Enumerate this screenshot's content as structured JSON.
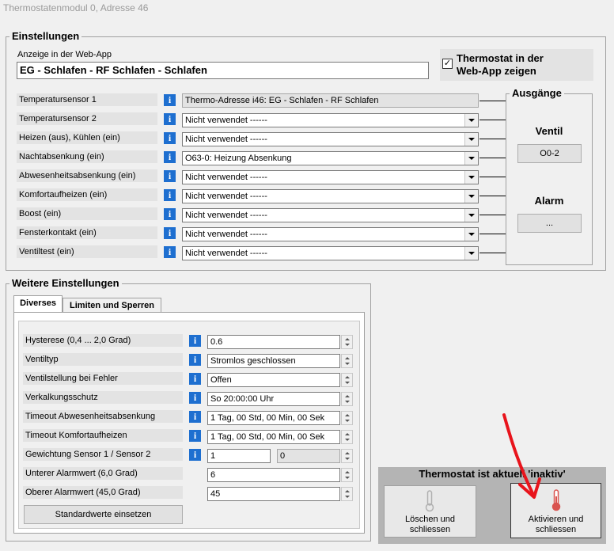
{
  "window": {
    "title": "Thermostatenmodul 0, Adresse 46"
  },
  "einstellungen": {
    "legend": "Einstellungen",
    "webapp_label": "Anzeige in der Web-App",
    "webapp_value": "EG - Schlafen - RF Schlafen - Schlafen",
    "checkbox_label_1": "Thermostat in der",
    "checkbox_label_2": "Web-App zeigen",
    "checkbox_mark": "✓",
    "info_glyph": "i",
    "rows": [
      {
        "label": "Temperatursensor 1",
        "value": "Thermo-Adresse i46: EG - Schlafen - RF Schlafen"
      },
      {
        "label": "Temperatursensor 2",
        "value": "Nicht verwendet ------"
      },
      {
        "label": "Heizen (aus), Kühlen (ein)",
        "value": "Nicht verwendet ------"
      },
      {
        "label": "Nachtabsenkung (ein)",
        "value": "O63-0: Heizung Absenkung"
      },
      {
        "label": "Abwesenheitsabsenkung (ein)",
        "value": "Nicht verwendet ------"
      },
      {
        "label": "Komfortaufheizen (ein)",
        "value": "Nicht verwendet ------"
      },
      {
        "label": "Boost (ein)",
        "value": "Nicht verwendet ------"
      },
      {
        "label": "Fensterkontakt (ein)",
        "value": "Nicht verwendet ------"
      },
      {
        "label": "Ventiltest (ein)",
        "value": "Nicht verwendet ------"
      }
    ]
  },
  "ausgaenge": {
    "legend": "Ausgänge",
    "ventil_label": "Ventil",
    "ventil_button": "O0-2",
    "alarm_label": "Alarm",
    "alarm_button": "..."
  },
  "weitere": {
    "legend": "Weitere Einstellungen",
    "tabs": [
      "Diverses",
      "Limiten und Sperren"
    ],
    "rows": [
      {
        "label": "Hysterese (0,4 ... 2,0 Grad)",
        "value": "0.6"
      },
      {
        "label": "Ventiltyp",
        "value": "Stromlos geschlossen"
      },
      {
        "label": "Ventilstellung bei Fehler",
        "value": "Offen"
      },
      {
        "label": "Verkalkungsschutz",
        "value": "So 20:00:00 Uhr"
      },
      {
        "label": "Timeout Abwesenheitsabsenkung",
        "value": "1 Tag, 00 Std, 00 Min, 00 Sek"
      },
      {
        "label": "Timeout Komfortaufheizen",
        "value": "1 Tag, 00 Std, 00 Min, 00 Sek"
      }
    ],
    "gewichtung": {
      "label": "Gewichtung Sensor 1 / Sensor 2",
      "value1": "1",
      "value2": "0"
    },
    "unterer": {
      "label": "Unterer Alarmwert (6,0 Grad)",
      "value": "6"
    },
    "oberer": {
      "label": "Oberer Alarmwert (45,0 Grad)",
      "value": "45"
    },
    "standard_button": "Standardwerte einsetzen"
  },
  "status": {
    "title": "Thermostat ist aktuell 'inaktiv'",
    "delete_button_1": "Löschen und",
    "delete_button_2": "schliessen",
    "activate_button_1": "Aktivieren und",
    "activate_button_2": "schliessen"
  },
  "colors": {
    "info": "#1e6fd0",
    "arrow": "#e8141c",
    "thermometer": "#d9534f"
  }
}
